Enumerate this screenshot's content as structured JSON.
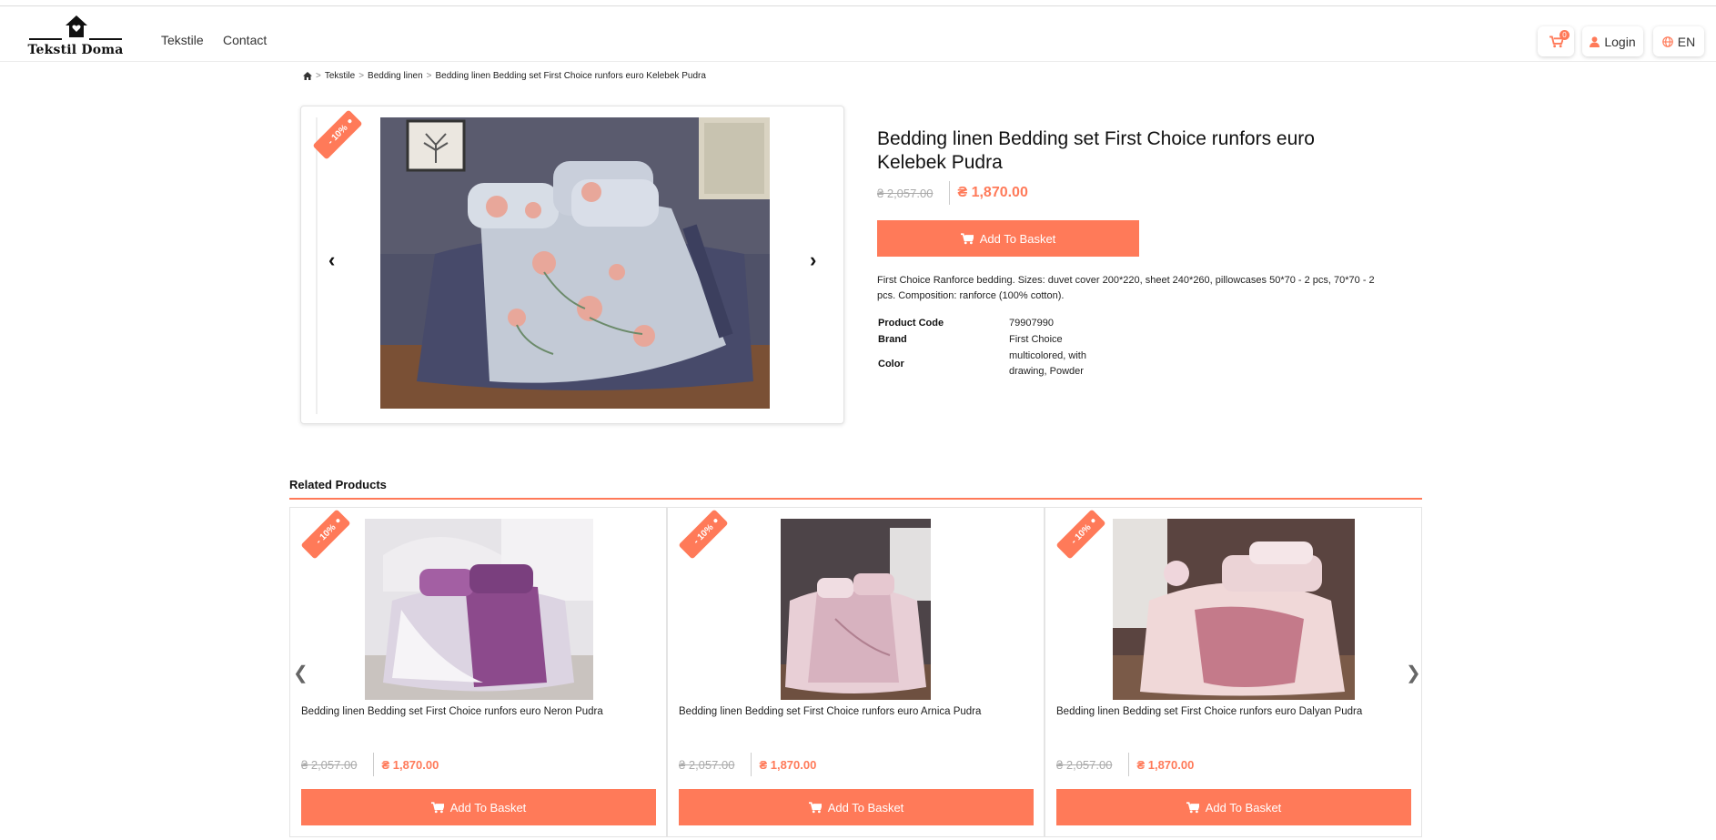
{
  "header": {
    "logo_text": "Tekstil Doma",
    "nav": [
      "Tekstile",
      "Contact"
    ],
    "cart_count": "0",
    "login_label": "Login",
    "lang_label": "EN"
  },
  "breadcrumb": [
    "Tekstile",
    "Bedding linen",
    "Bedding linen Bedding set First Choice runfors euro Kelebek Pudra"
  ],
  "product": {
    "discount": "- 10%",
    "title": "Bedding linen Bedding set First Choice runfors euro Kelebek Pudra",
    "old_price": "₴ 2,057.00",
    "price": "₴ 1,870.00",
    "add_label": "Add To Basket",
    "description": "First Choice Ranforce bedding. Sizes: duvet cover 200*220, sheet 240*260, pillowcases 50*70 - 2 pcs, 70*70 - 2 pcs. Composition: ranforce (100% cotton).",
    "specs": [
      {
        "key": "Product Code",
        "value": "79907990"
      },
      {
        "key": "Brand",
        "value": "First Choice"
      },
      {
        "key": "Color",
        "value": "multicolored, with drawing, Powder"
      }
    ]
  },
  "related": {
    "title": "Related Products",
    "items": [
      {
        "name": "Bedding linen Bedding set First Choice runfors euro Neron Pudra",
        "discount": "- 10%",
        "old_price": "₴ 2,057.00",
        "price": "₴ 1,870.00",
        "add_label": "Add To Basket"
      },
      {
        "name": "Bedding linen Bedding set First Choice runfors euro Arnica Pudra",
        "discount": "- 10%",
        "old_price": "₴ 2,057.00",
        "price": "₴ 1,870.00",
        "add_label": "Add To Basket"
      },
      {
        "name": "Bedding linen Bedding set First Choice runfors euro Dalyan Pudra",
        "discount": "- 10%",
        "old_price": "₴ 2,057.00",
        "price": "₴ 1,870.00",
        "add_label": "Add To Basket"
      }
    ]
  },
  "colors": {
    "accent": "#ff7a59"
  },
  "icons": [
    "home-icon",
    "cart-icon",
    "user-icon",
    "globe-icon",
    "chevron-left-icon",
    "chevron-right-icon"
  ]
}
